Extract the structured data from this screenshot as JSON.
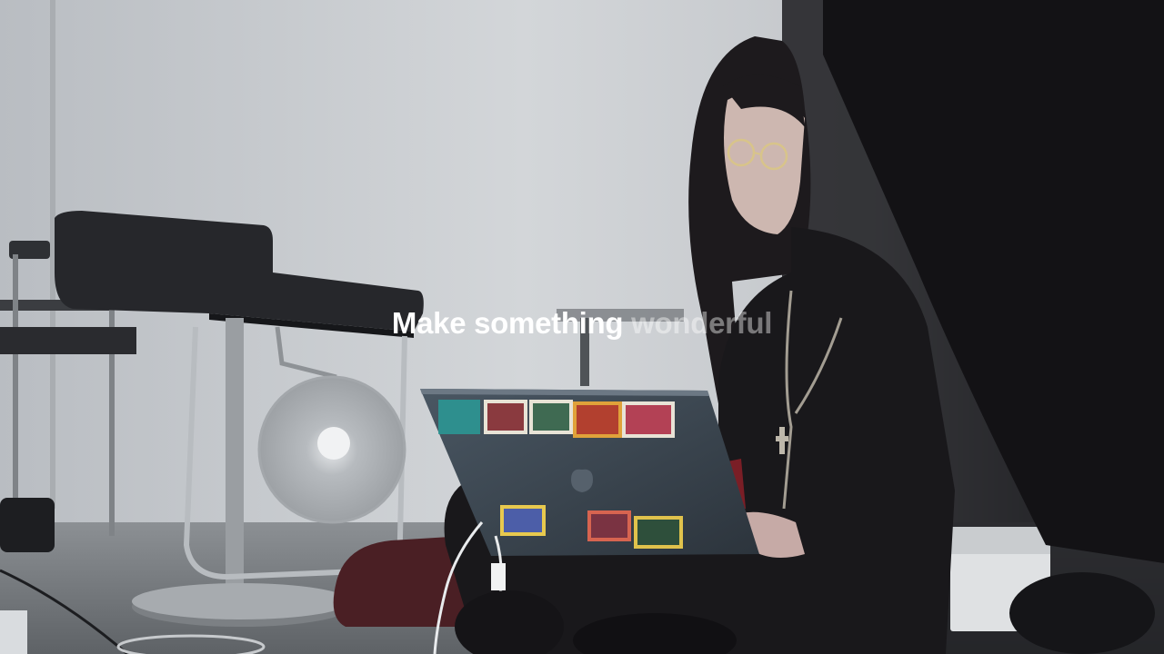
{
  "headline": {
    "lit_text": "Make something",
    "dim_text": "wonderful"
  },
  "colors": {
    "wall": "#c9ccd0",
    "floor": "#8f9397",
    "headline_lit": "#ffffff",
    "headline_dim": "#8a8c90"
  }
}
